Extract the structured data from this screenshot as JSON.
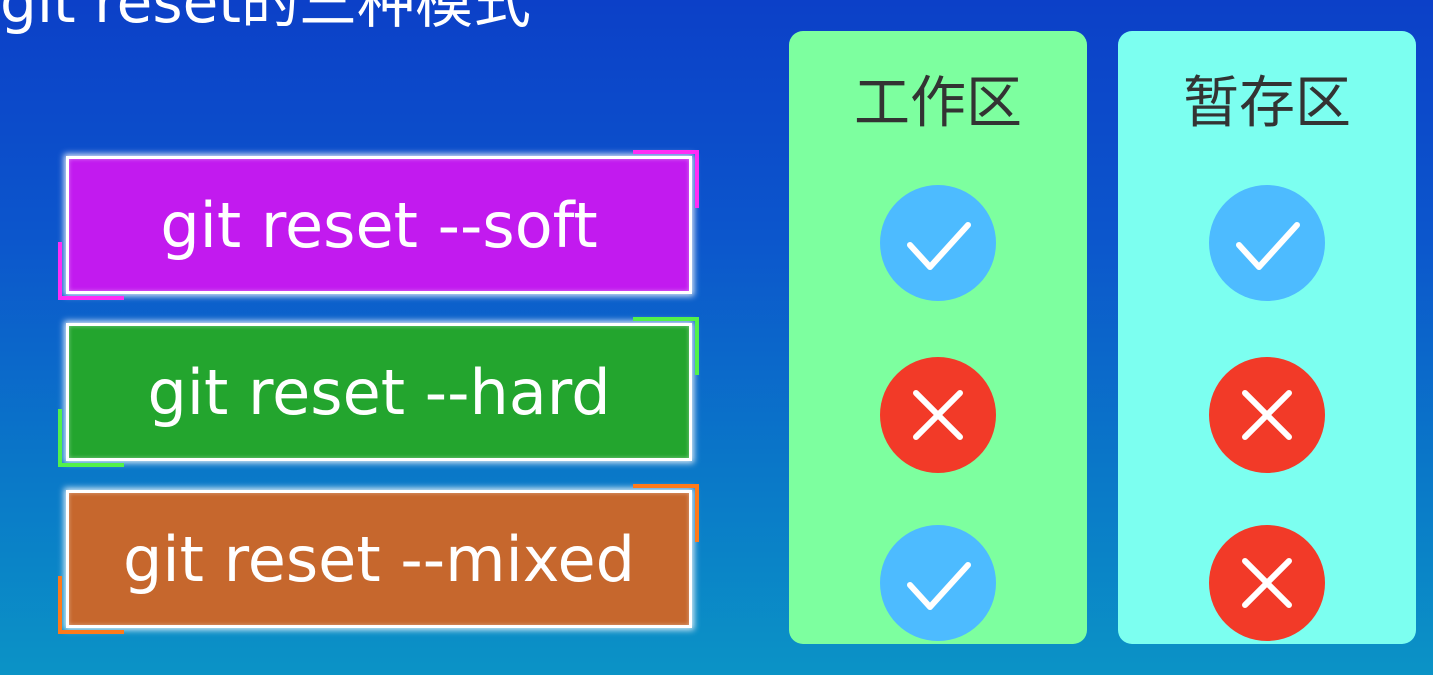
{
  "title": "git reset的三种模式",
  "modes": [
    {
      "label": "git reset --soft",
      "color": "#c21aef"
    },
    {
      "label": "git reset --hard",
      "color": "#23a52e"
    },
    {
      "label": "git reset --mixed",
      "color": "#c6672d"
    }
  ],
  "columns": [
    {
      "header": "工作区",
      "color": "#7dff9f",
      "marks": [
        "check-icon",
        "cross-icon",
        "check-icon"
      ]
    },
    {
      "header": "暂存区",
      "color": "#7cfff0",
      "marks": [
        "check-icon",
        "cross-icon",
        "cross-icon"
      ]
    }
  ],
  "colors": {
    "check": "#4dbbff",
    "cross": "#f23a28"
  }
}
